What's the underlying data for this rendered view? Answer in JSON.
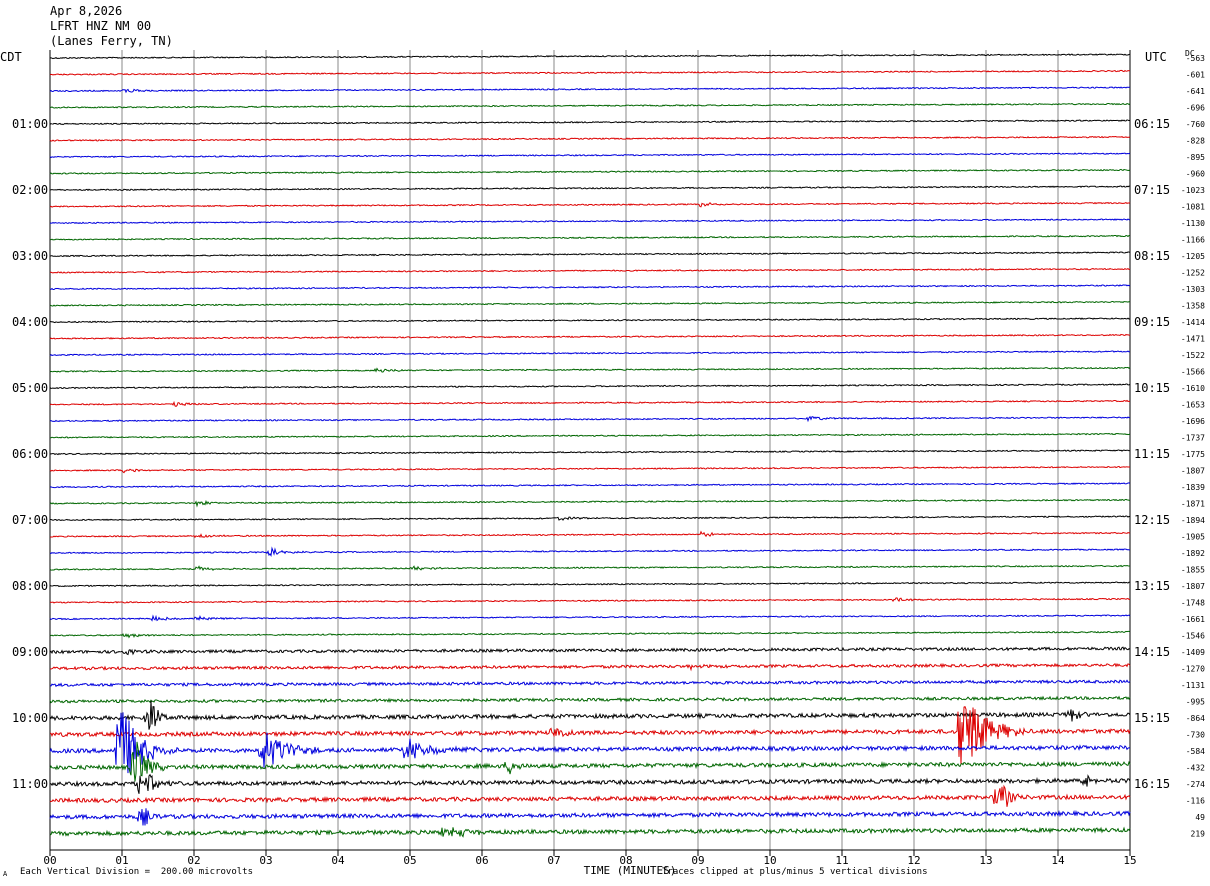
{
  "header": {
    "date": "Apr 8,2026",
    "station": "LFRT HNZ NM 00",
    "location": "(Lanes Ferry, TN)"
  },
  "left_tz": "CDT",
  "right_tz": "UTC",
  "dc_label": "DC",
  "footer": {
    "scale_note": "Each Vertical Division =  200.00 microvolts",
    "clip_note": "Traces clipped at plus/minus 5 vertical divisions",
    "corner_mark": "A"
  },
  "chart_data": {
    "type": "line",
    "xlabel": "TIME (MINUTES)",
    "x_ticks": [
      "00",
      "01",
      "02",
      "03",
      "04",
      "05",
      "06",
      "07",
      "08",
      "09",
      "10",
      "11",
      "12",
      "13",
      "14",
      "15"
    ],
    "xlim": [
      0,
      15
    ],
    "trace_colors": [
      "#000000",
      "#dd0000",
      "#0000dd",
      "#006600"
    ],
    "left_hour_labels": [
      "01:00",
      "02:00",
      "03:00",
      "04:00",
      "05:00",
      "06:00",
      "07:00",
      "08:00",
      "09:00",
      "10:00",
      "11:00"
    ],
    "right_hour_labels": [
      "06:15",
      "07:15",
      "08:15",
      "09:15",
      "10:15",
      "11:15",
      "12:15",
      "13:15",
      "14:15",
      "15:15",
      "16:15"
    ],
    "dc_offsets": [
      "-563",
      "-601",
      "-641",
      "-696",
      "-760",
      "-828",
      "-895",
      "-960",
      "-1023",
      "-1081",
      "-1130",
      "-1166",
      "-1205",
      "-1252",
      "-1303",
      "-1358",
      "-1414",
      "-1471",
      "-1522",
      "-1566",
      "-1610",
      "-1653",
      "-1696",
      "-1737",
      "-1775",
      "-1807",
      "-1839",
      "-1871",
      "-1894",
      "-1905",
      "-1892",
      "-1855",
      "-1807",
      "-1748",
      "-1661",
      "-1546",
      "-1409",
      "-1270",
      "-1131",
      "-995",
      "-864",
      "-730",
      "-584",
      "-432",
      "-274",
      "-116",
      "49",
      "219"
    ],
    "trace_count": 48,
    "events": [
      {
        "trace": 2,
        "minute": 1.0,
        "amp": 0.6
      },
      {
        "trace": 9,
        "minute": 9.0,
        "amp": 0.6
      },
      {
        "trace": 19,
        "minute": 4.5,
        "amp": 0.6
      },
      {
        "trace": 21,
        "minute": 1.7,
        "amp": 0.6
      },
      {
        "trace": 29,
        "minute": 9.0,
        "amp": 0.6
      },
      {
        "trace": 31,
        "minute": 5.0,
        "amp": 0.6
      },
      {
        "trace": 34,
        "minute": 1.4,
        "amp": 0.6
      },
      {
        "trace": 35,
        "minute": 1.0,
        "amp": 0.6
      },
      {
        "trace": 27,
        "minute": 2.0,
        "amp": 0.6
      },
      {
        "trace": 25,
        "minute": 1.0,
        "amp": 0.6
      },
      {
        "trace": 28,
        "minute": 7.0,
        "amp": 0.6
      },
      {
        "trace": 33,
        "minute": 11.7,
        "amp": 0.6
      },
      {
        "trace": 34,
        "minute": 2.0,
        "amp": 0.6
      },
      {
        "trace": 37,
        "minute": 8.9,
        "amp": 0.6
      },
      {
        "trace": 22,
        "minute": 10.5,
        "amp": 0.6
      },
      {
        "trace": 29,
        "minute": 2.0,
        "amp": 0.6
      },
      {
        "trace": 31,
        "minute": 2.0,
        "amp": 0.6
      },
      {
        "trace": 30,
        "minute": 3.0,
        "amp": 0.6
      },
      {
        "trace": 36,
        "minute": 1.0,
        "amp": 0.6
      },
      {
        "trace": 30,
        "minute": 3.0,
        "amp": 0.6
      }
    ]
  }
}
